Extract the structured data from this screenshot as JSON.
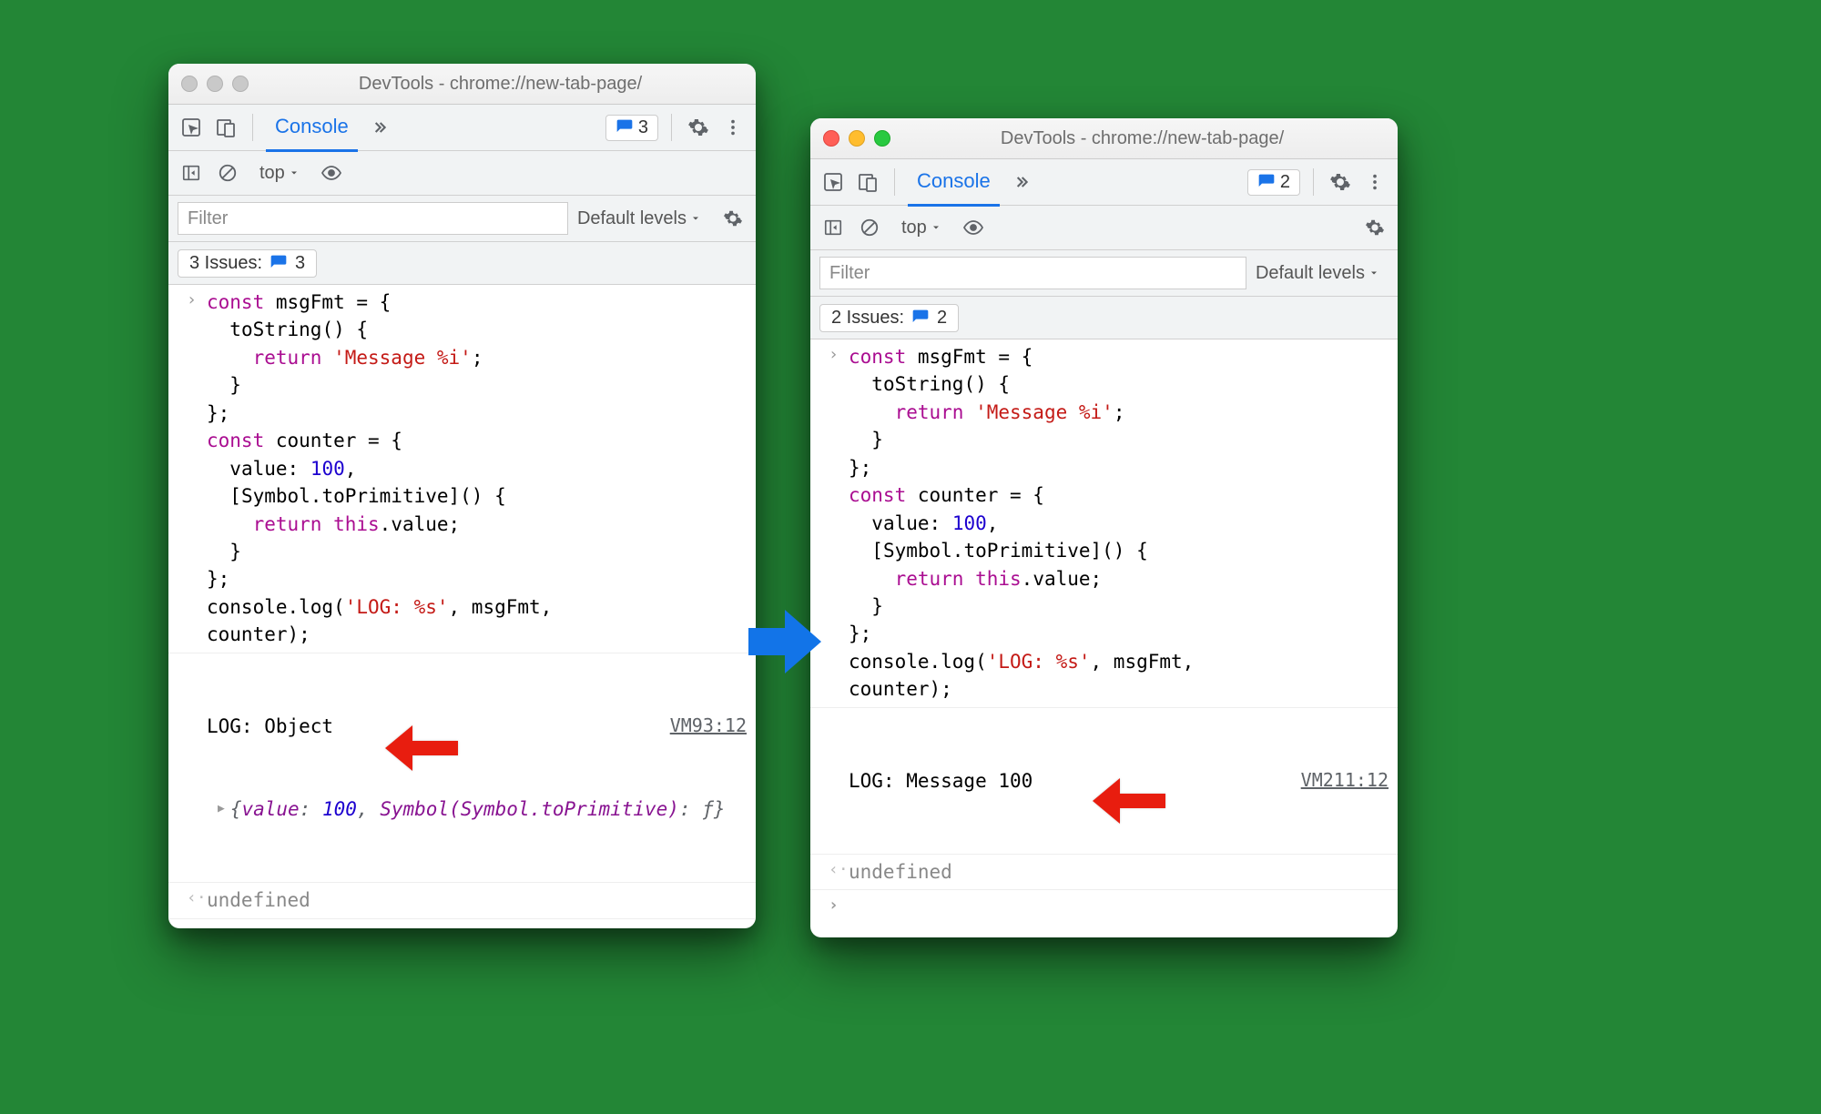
{
  "left": {
    "title": "DevTools - chrome://new-tab-page/",
    "tab": "Console",
    "badge_count": "3",
    "context": "top",
    "filter_placeholder": "Filter",
    "levels": "Default levels",
    "issues_label": "3 Issues:",
    "issues_count": "3",
    "code_html": "<span class='kw'>const</span> msgFmt = {\n  toString() {\n    <span class='kw'>return</span> <span class='str'>'Message %i'</span>;\n  }\n};\n<span class='kw'>const</span> counter = {\n  value: <span class='num'>100</span>,\n  [Symbol.toPrimitive]() {\n    <span class='kw'>return</span> <span class='kw'>this</span>.value;\n  }\n};\nconsole.log(<span class='str'>'LOG: %s'</span>, msgFmt,\ncounter);",
    "log_output": "LOG: Object",
    "log_source": "VM93:12",
    "obj_preview_html": "<span class='ital'>{<span class='key-it'>value</span>: <span class='num'>100</span>, <span class='key-it'>Symbol(Symbol.toPrimitive)</span>: ƒ}</span>",
    "return_value": "undefined"
  },
  "right": {
    "title": "DevTools - chrome://new-tab-page/",
    "tab": "Console",
    "badge_count": "2",
    "context": "top",
    "filter_placeholder": "Filter",
    "levels": "Default levels",
    "issues_label": "2 Issues:",
    "issues_count": "2",
    "code_html": "<span class='kw'>const</span> msgFmt = {\n  toString() {\n    <span class='kw'>return</span> <span class='str'>'Message %i'</span>;\n  }\n};\n<span class='kw'>const</span> counter = {\n  value: <span class='num'>100</span>,\n  [Symbol.toPrimitive]() {\n    <span class='kw'>return</span> <span class='kw'>this</span>.value;\n  }\n};\nconsole.log(<span class='str'>'LOG: %s'</span>, msgFmt,\ncounter);",
    "log_output": "LOG: Message 100",
    "log_source": "VM211:12",
    "return_value": "undefined"
  }
}
